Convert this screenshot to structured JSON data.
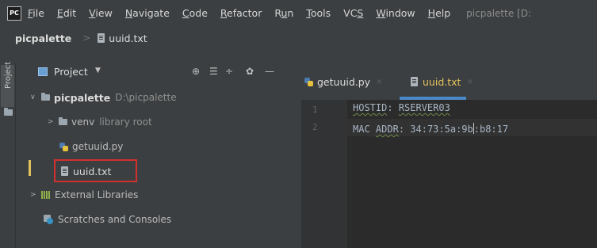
{
  "menubar": {
    "logo": "PC",
    "items": [
      {
        "pre": "",
        "ul": "F",
        "post": "ile"
      },
      {
        "pre": "",
        "ul": "E",
        "post": "dit"
      },
      {
        "pre": "",
        "ul": "V",
        "post": "iew"
      },
      {
        "pre": "",
        "ul": "N",
        "post": "avigate"
      },
      {
        "pre": "",
        "ul": "C",
        "post": "ode"
      },
      {
        "pre": "",
        "ul": "R",
        "post": "efactor"
      },
      {
        "pre": "R",
        "ul": "u",
        "post": "n"
      },
      {
        "pre": "",
        "ul": "T",
        "post": "ools"
      },
      {
        "pre": "VC",
        "ul": "S",
        "post": ""
      },
      {
        "pre": "",
        "ul": "W",
        "post": "indow"
      },
      {
        "pre": "",
        "ul": "H",
        "post": "elp"
      }
    ],
    "window_title": "picpalette [D:"
  },
  "breadcrumb": {
    "project": "picpalette",
    "separator": ">",
    "file": "uuid.txt"
  },
  "sidebar": {
    "tab_label": "Project"
  },
  "project_panel": {
    "title": "Project",
    "dropdown_glyph": "▼",
    "tools": [
      "⊕",
      "☰",
      "÷",
      "✿",
      "—"
    ]
  },
  "tree": {
    "root": {
      "chevron": "∨",
      "name": "picpalette",
      "path": "D:\\picpalette"
    },
    "venv": {
      "chevron": ">",
      "name": "venv",
      "note": "library root"
    },
    "getuuid": "getuuid.py",
    "uuid": "uuid.txt",
    "ext_libs": {
      "chevron": ">",
      "name": "External Libraries"
    },
    "scratches": "Scratches and Consoles"
  },
  "editor": {
    "tabs": [
      {
        "label": "getuuid.py",
        "active": false
      },
      {
        "label": "uuid.txt",
        "active": true
      }
    ],
    "close_glyph": "×",
    "line_numbers": [
      "1",
      "2"
    ],
    "line1": {
      "w1": "HOSTID",
      "sep": ": ",
      "w2": "RSERVER03"
    },
    "line2": {
      "w1": "MAC",
      "sp": " ",
      "w2": "ADDR",
      "before_caret": ": 34:73:5a:9b",
      "after_caret": ":b8:17"
    }
  },
  "colors": {
    "accent_tab": "#4a88c7",
    "selection_marker": "#e2c15a",
    "highlight_box": "#d2302f"
  }
}
